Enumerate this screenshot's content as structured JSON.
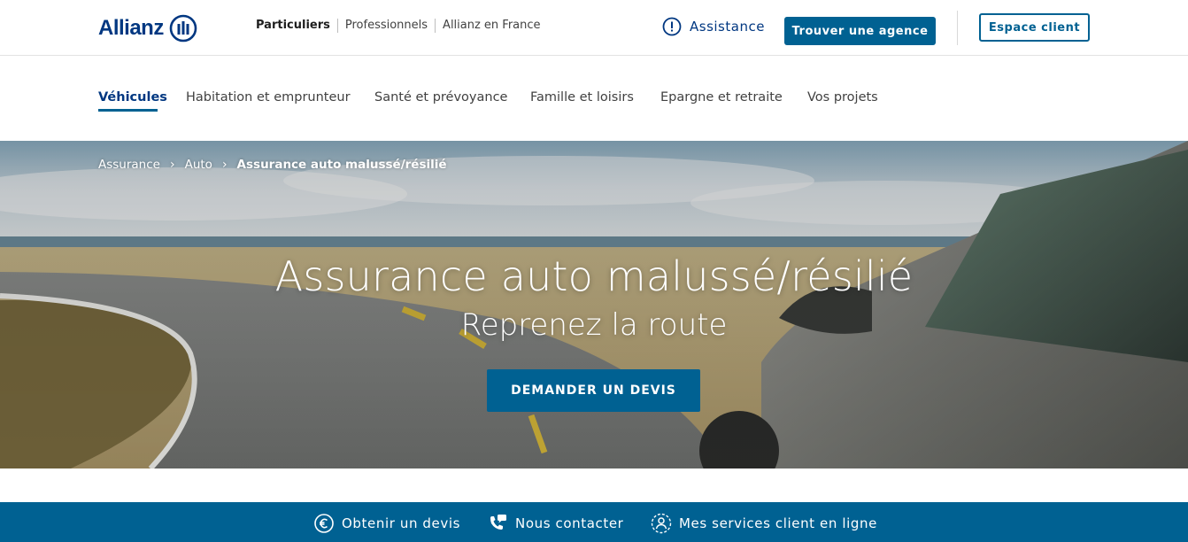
{
  "header": {
    "logo_text": "Allianz",
    "audience_links": [
      "Particuliers",
      "Professionnels",
      "Allianz en France"
    ],
    "assistance_label": "Assistance",
    "agence_button": "Trouver une agence",
    "espace_client_button": "Espace client"
  },
  "nav": {
    "items": [
      "Véhicules",
      "Habitation et emprunteur",
      "Santé et prévoyance",
      "Famille et loisirs",
      "Epargne et retraite",
      "Vos projets"
    ],
    "active_index": 0
  },
  "hero": {
    "breadcrumb": [
      "Assurance",
      "Auto",
      "Assurance auto malussé/résilié"
    ],
    "title": "Assurance auto malussé/résilié",
    "subtitle": "Reprenez la route",
    "cta": "DEMANDER UN DEVIS"
  },
  "actions": {
    "devis": "Obtenir un devis",
    "contact": "Nous contacter",
    "services": "Mes services client en ligne"
  },
  "colors": {
    "brand_dark": "#003781",
    "brand_blue": "#006192",
    "text": "#414141"
  },
  "icons": [
    "allianz-logo-icon",
    "assistance-icon",
    "euro-icon",
    "phone-chat-icon",
    "user-services-icon",
    "chevron-right-icon"
  ]
}
